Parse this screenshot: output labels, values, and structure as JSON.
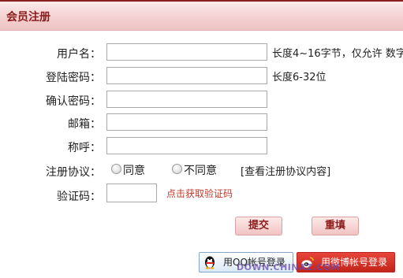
{
  "header": {
    "title": "会员注册"
  },
  "form": {
    "username": {
      "label": "用户名：",
      "value": "",
      "hint": "长度4~16字节，仅允许 数字"
    },
    "password": {
      "label": "登陆密码：",
      "value": "",
      "hint": "长度6-32位"
    },
    "confirm_password": {
      "label": "确认密码：",
      "value": ""
    },
    "email": {
      "label": "邮箱：",
      "value": ""
    },
    "nickname": {
      "label": "称呼：",
      "value": ""
    },
    "agreement": {
      "label": "注册协议：",
      "agree": "同意",
      "disagree": "不同意",
      "view_link": "[查看注册协议内容]"
    },
    "captcha": {
      "label": "验证码：",
      "value": "",
      "get_link": "点击获取验证码"
    }
  },
  "actions": {
    "submit": "提交",
    "reset": "重填"
  },
  "social_login": {
    "qq": "用QQ帐号登录",
    "weibo": "用微博帐号登录"
  },
  "watermark": "DOWN.CHINAZ.COM",
  "colors": {
    "accent": "#8b1a1a",
    "captcha_link": "#c0392b",
    "weibo": "#d6302a"
  }
}
